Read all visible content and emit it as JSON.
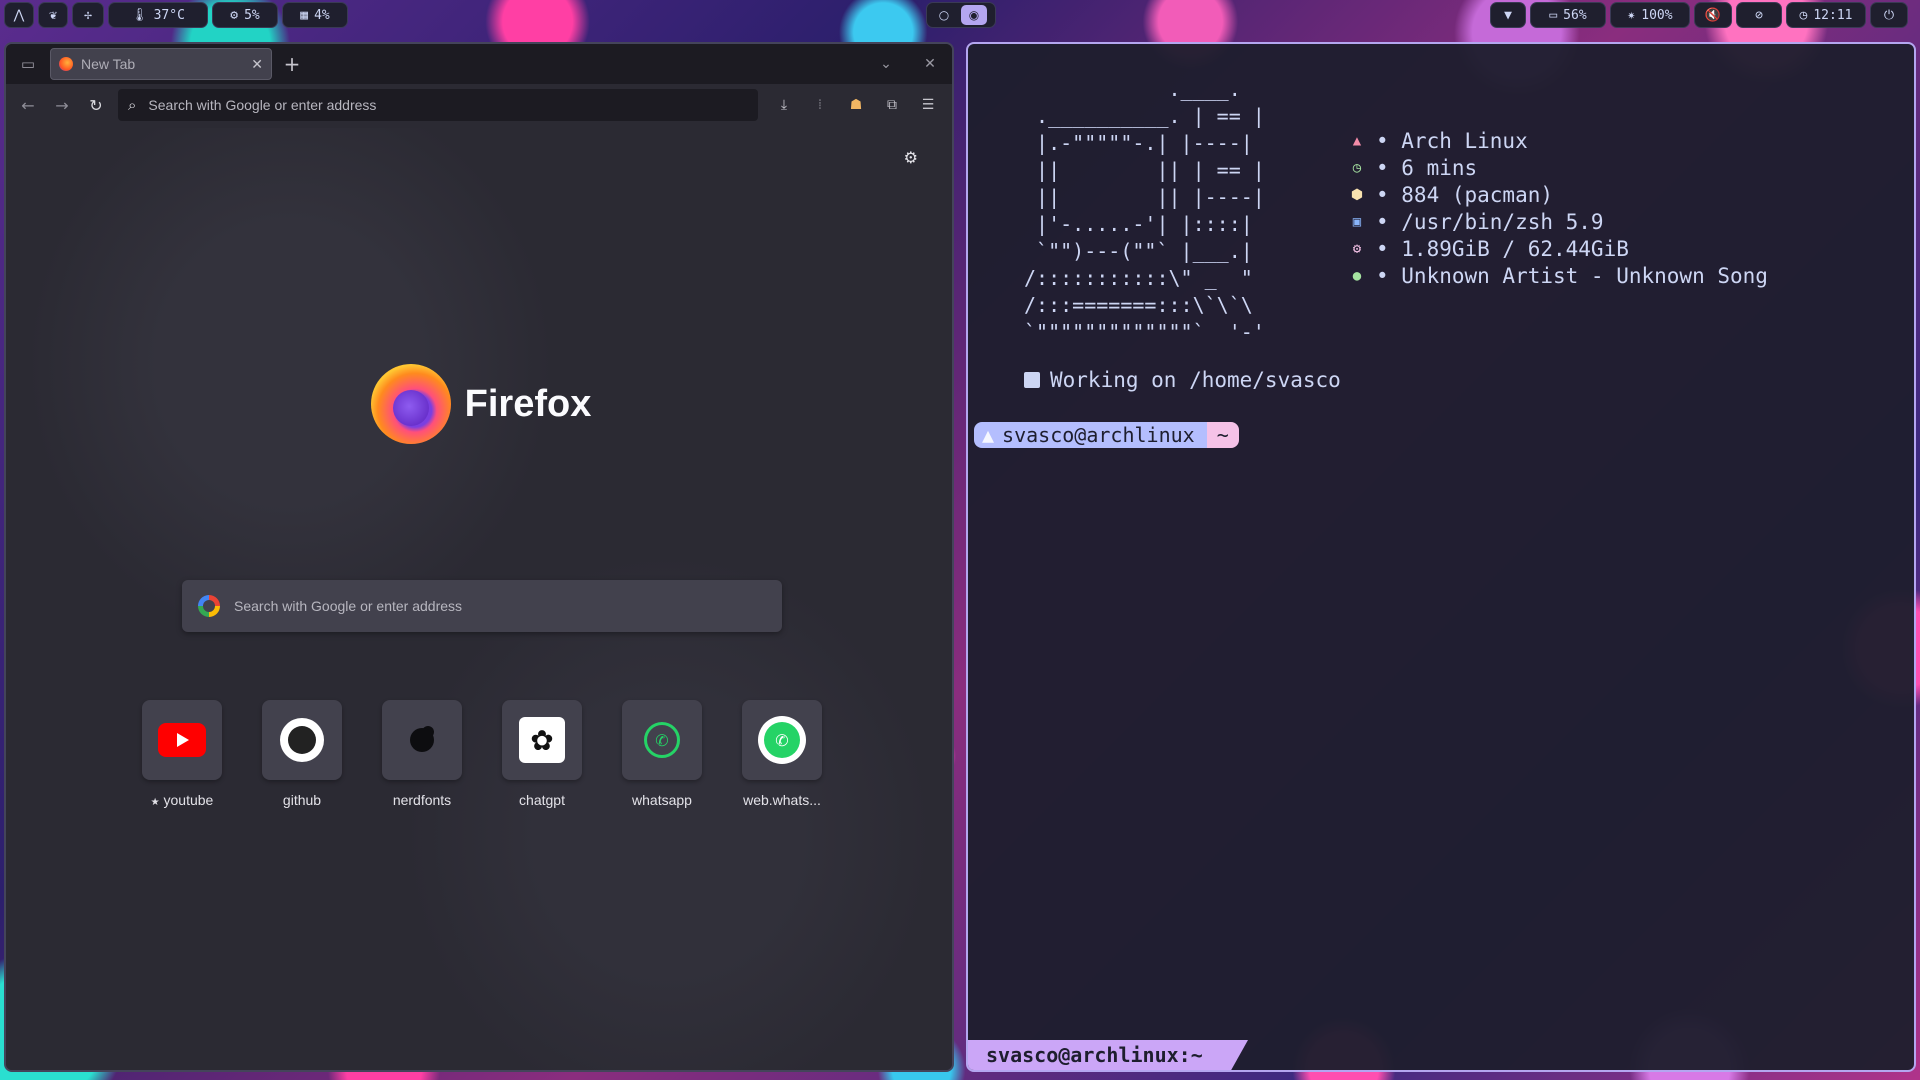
{
  "colors": {
    "accent": "#b4a6f0",
    "terminal_bg": "#1e1e2e",
    "firefox_bg": "#2b2a33",
    "prompt_user": "#b4befe",
    "prompt_dir": "#f5c2e7",
    "status_bar": "#cba6f7"
  },
  "topbar": {
    "left": [
      {
        "icon": "arch-icon"
      },
      {
        "icon": "leaf-icon"
      },
      {
        "icon": "fan-icon"
      },
      {
        "icon": "thermometer-icon",
        "text": "37°C"
      },
      {
        "icon": "cpu-icon",
        "text": "5%"
      },
      {
        "icon": "memory-icon",
        "text": "4%"
      }
    ],
    "workspaces": [
      "1",
      "2"
    ],
    "right": [
      {
        "icon": "wifi-icon"
      },
      {
        "icon": "battery-icon",
        "text": "56%"
      },
      {
        "icon": "brightness-icon",
        "text": "100%"
      },
      {
        "icon": "volume-muted-icon"
      },
      {
        "icon": "mic-muted-icon"
      },
      {
        "icon": "clock-icon",
        "text": "12:11"
      },
      {
        "icon": "power-icon"
      }
    ]
  },
  "firefox": {
    "tab_title": "New Tab",
    "url_placeholder": "Search with Google or enter address",
    "wordmark": "Firefox",
    "search_placeholder": "Search with Google or enter address",
    "shortcuts": [
      {
        "label": "youtube",
        "pinned": true,
        "icon": "youtube-icon"
      },
      {
        "label": "github",
        "icon": "github-icon"
      },
      {
        "label": "nerdfonts",
        "icon": "nerdfonts-icon"
      },
      {
        "label": "chatgpt",
        "icon": "chatgpt-icon"
      },
      {
        "label": "whatsapp",
        "icon": "whatsapp-icon"
      },
      {
        "label": "web.whats...",
        "icon": "whatsapp-web-icon"
      }
    ]
  },
  "terminal": {
    "ascii_art": "            .____.\n .__________. | == |\n |.-\"\"\"\"\"-.| |----|\n ||        || | == |\n ||        || |----|\n |'-.....-'| |::::|\n `\"\")---(\"\"` |___.|\n/:::::::::::\\\" _  \"\n/:::=======:::\\`\\`\\\n`\"\"\"\"\"\"\"\"\"\"\"\"\"`  '-'",
    "info": [
      {
        "icon": "arch-icon",
        "color": "#f38ba8",
        "text": "• Arch Linux"
      },
      {
        "icon": "clock-icon",
        "color": "#a6e3a1",
        "text": "• 6 mins"
      },
      {
        "icon": "package-icon",
        "color": "#f9e2af",
        "text": "• 884 (pacman)"
      },
      {
        "icon": "terminal-icon",
        "color": "#89b4fa",
        "text": "• /usr/bin/zsh 5.9"
      },
      {
        "icon": "chip-icon",
        "color": "#f5c2e7",
        "text": "• 1.89GiB / 62.44GiB"
      },
      {
        "icon": "spotify-icon",
        "color": "#a6e3a1",
        "text": "• Unknown Artist - Unknown Song"
      }
    ],
    "working": "Working on /home/svasco",
    "prompt_user": "svasco@archlinux",
    "prompt_dir": "~",
    "status": "svasco@archlinux:~"
  }
}
